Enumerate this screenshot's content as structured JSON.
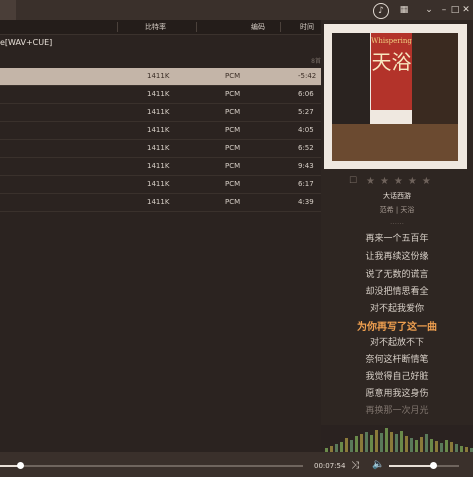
{
  "header": {
    "bitrate": "比特率",
    "encoding": "编码",
    "duration": "时间"
  },
  "album_label": "e[WAV+CUE]",
  "count_label": "8首",
  "tracks": [
    {
      "bitrate": "1411K",
      "encoding": "PCM",
      "duration": "-5:42"
    },
    {
      "bitrate": "1411K",
      "encoding": "PCM",
      "duration": "6:06"
    },
    {
      "bitrate": "1411K",
      "encoding": "PCM",
      "duration": "5:27"
    },
    {
      "bitrate": "1411K",
      "encoding": "PCM",
      "duration": "4:05"
    },
    {
      "bitrate": "1411K",
      "encoding": "PCM",
      "duration": "6:52"
    },
    {
      "bitrate": "1411K",
      "encoding": "PCM",
      "duration": "9:43"
    },
    {
      "bitrate": "1411K",
      "encoding": "PCM",
      "duration": "6:17"
    },
    {
      "bitrate": "1411K",
      "encoding": "PCM",
      "duration": "4:39"
    }
  ],
  "now_playing": {
    "title": "大话西游",
    "artist": "范希 | 天浴",
    "rating": 0,
    "cover_text_small": "Whispering",
    "cover_text_big": "天浴"
  },
  "lyrics": {
    "prev": [
      "再来一个五百年",
      "让我再续这份缘",
      "说了无数的谎言",
      "却没把情思看全",
      "对不起我爱你"
    ],
    "current": "为你再写了这一曲",
    "next": [
      "对不起放不下",
      "奈何这杆断情笔",
      "我觉得自己好脏",
      "愿意用我这身伤",
      "再换那一次月光"
    ]
  },
  "player": {
    "time": "00:07:54",
    "progress_fraction": 0.066,
    "volume_fraction": 0.63
  },
  "icons": {
    "note": "music-note-icon",
    "grid": "grid-icon",
    "chevron": "chevron-down-icon",
    "minimize": "minimize-icon",
    "maximize": "maximize-icon",
    "close": "close-icon"
  }
}
